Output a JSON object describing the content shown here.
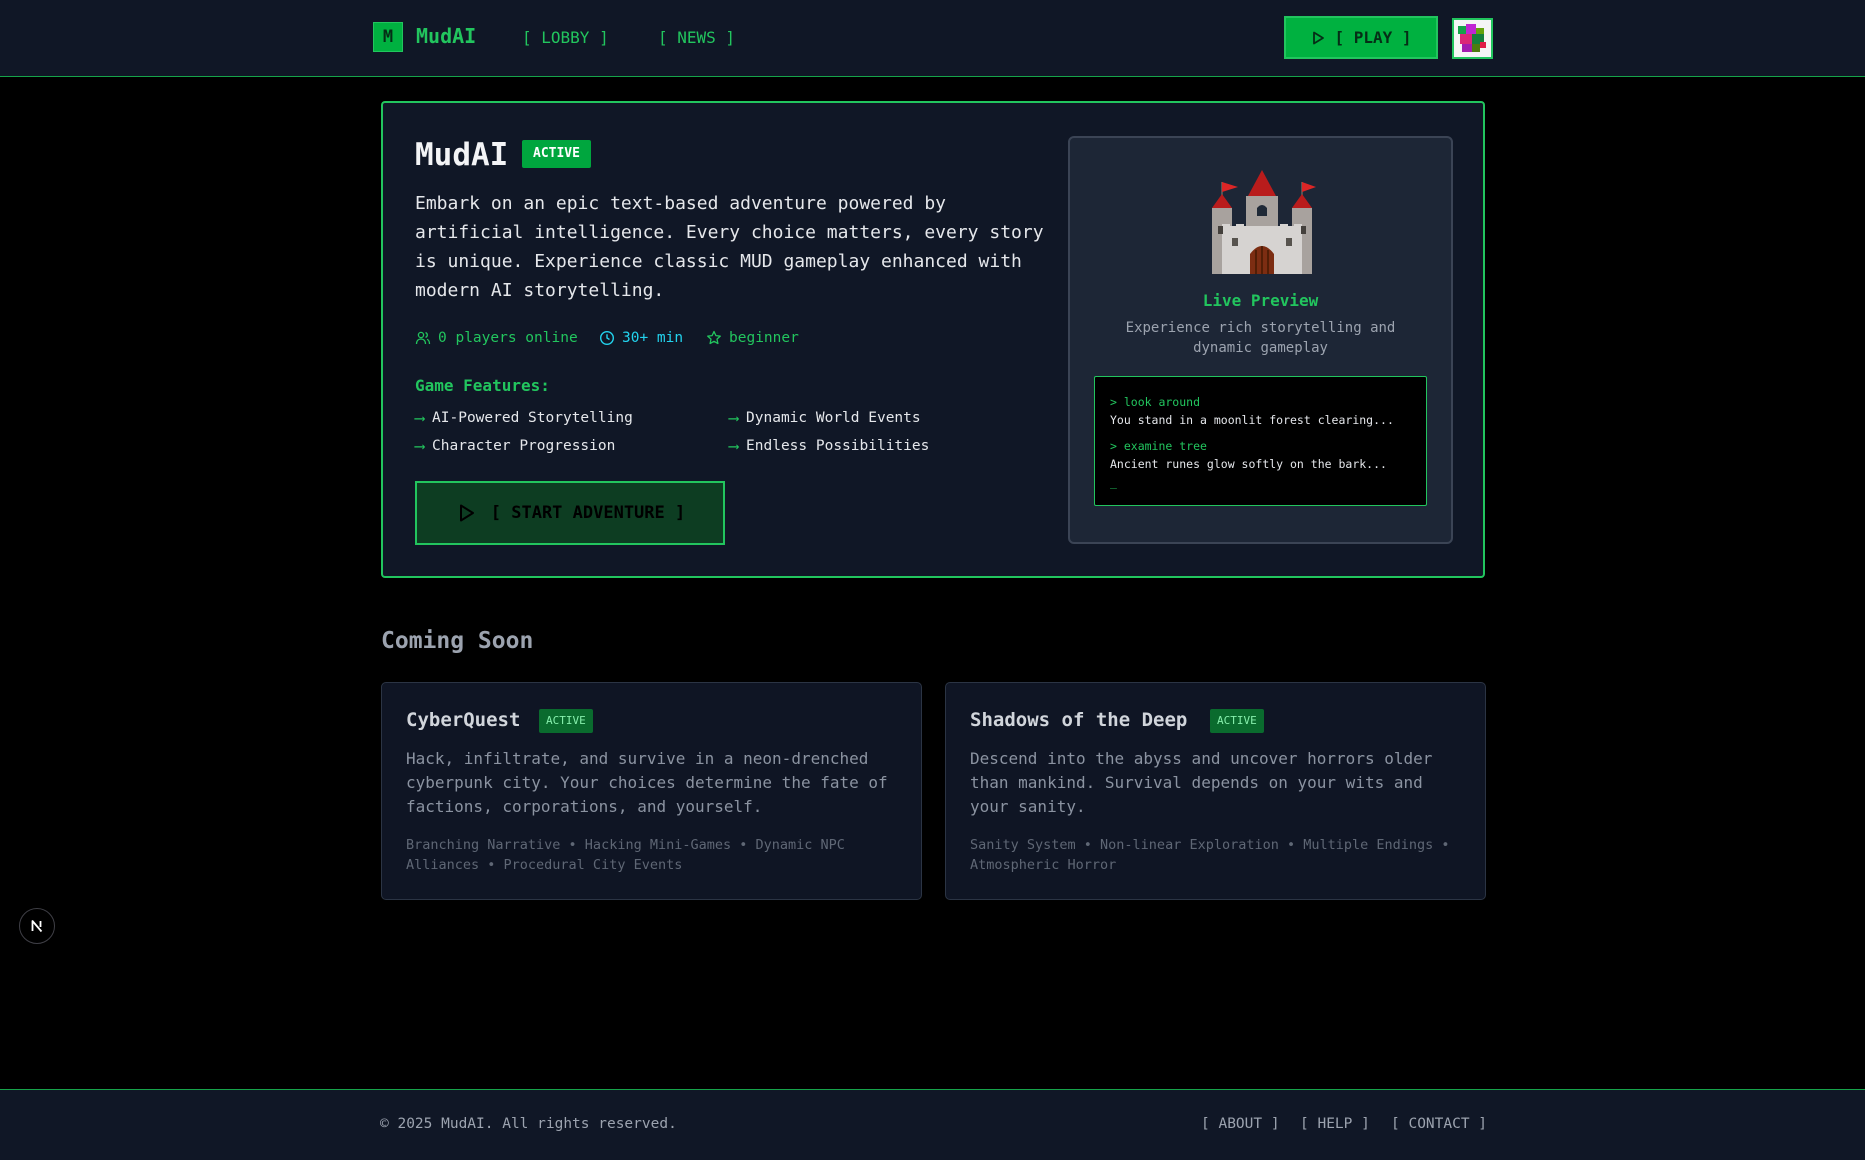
{
  "header": {
    "logo_letter": "M",
    "logo_text": "MudAI",
    "nav": [
      {
        "label": "[ LOBBY ]"
      },
      {
        "label": "[ NEWS ]"
      }
    ],
    "play_label": "[ PLAY ]"
  },
  "featured": {
    "title": "MudAI",
    "status": "ACTIVE",
    "description": "Embark on an epic text-based adventure powered by artificial intelligence. Every choice matters, every story is unique. Experience classic MUD gameplay enhanced with modern AI storytelling.",
    "stats": {
      "players": "0 players online",
      "duration": "30+ min",
      "difficulty": "beginner"
    },
    "features_title": "Game Features:",
    "features": [
      "AI-Powered Storytelling",
      "Dynamic World Events",
      "Character Progression",
      "Endless Possibilities"
    ],
    "start_label": "[ START ADVENTURE ]",
    "preview": {
      "title": "Live Preview",
      "subtitle": "Experience rich storytelling and dynamic gameplay",
      "terminal": [
        {
          "cmd": "> look around",
          "out": "You stand in a moonlit forest clearing..."
        },
        {
          "cmd": "> examine tree",
          "out": "Ancient runes glow softly on the bark..."
        }
      ],
      "cursor": "_"
    }
  },
  "coming_soon": {
    "title": "Coming Soon",
    "games": [
      {
        "title": "CyberQuest",
        "status": "ACTIVE",
        "description": "Hack, infiltrate, and survive in a neon-drenched cyberpunk city. Your choices determine the fate of factions, corporations, and yourself.",
        "tags": "Branching Narrative • Hacking Mini-Games • Dynamic NPC Alliances • Procedural City Events"
      },
      {
        "title": "Shadows of the Deep",
        "status": "ACTIVE",
        "description": "Descend into the abyss and uncover horrors older than mankind. Survival depends on your wits and your sanity.",
        "tags": "Sanity System • Non-linear Exploration • Multiple Endings • Atmospheric Horror"
      }
    ]
  },
  "footer": {
    "copyright": "© 2025 MudAI. All rights reserved.",
    "links": [
      {
        "label": "[ ABOUT ]"
      },
      {
        "label": "[ HELP ]"
      },
      {
        "label": "[ CONTACT ]"
      }
    ]
  },
  "colors": {
    "accent": "#22c55e",
    "accent_fill": "#00b140",
    "panel": "#101726",
    "background": "#000000"
  },
  "icons": [
    "play-icon",
    "users-icon",
    "clock-icon",
    "star-icon",
    "arrow-right-icon",
    "castle-icon",
    "nextjs-icon"
  ]
}
